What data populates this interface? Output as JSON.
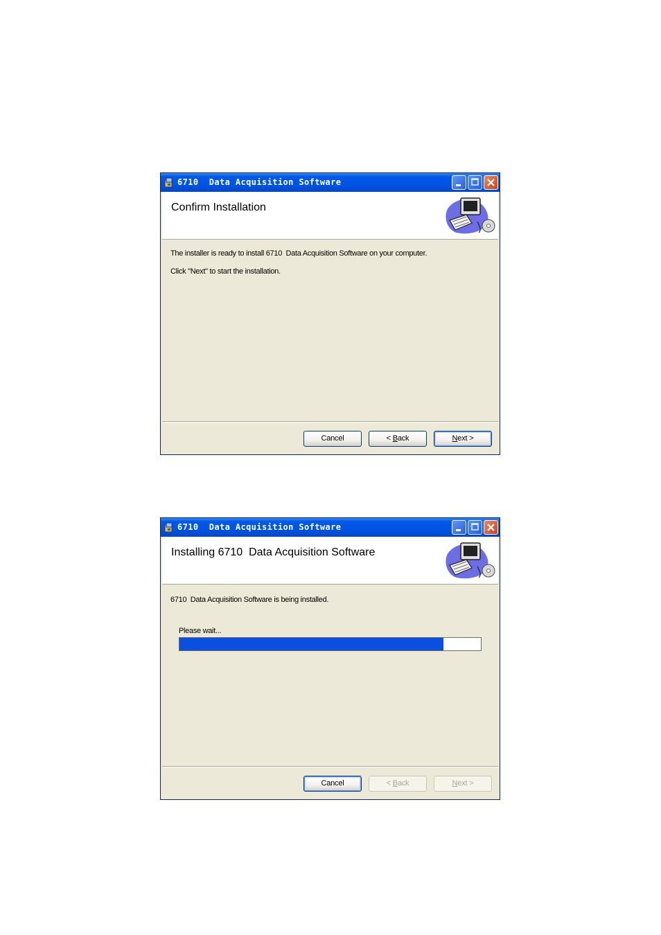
{
  "windows": [
    {
      "title": "6710  Data Acquisition Software",
      "header_title": "Confirm Installation",
      "body_lines": [
        "The installer is ready to install 6710  Data Acquisition Software on your computer.",
        "Click \"Next\" to start the installation."
      ],
      "buttons": {
        "cancel": {
          "label": "Cancel",
          "enabled": true
        },
        "back": {
          "prefix": "< ",
          "underlined": "B",
          "rest": "ack",
          "enabled": true
        },
        "next": {
          "underlined": "N",
          "rest": "ext >",
          "enabled": true,
          "default": true
        }
      }
    },
    {
      "title": "6710  Data Acquisition Software",
      "header_title": "Installing 6710  Data Acquisition Software",
      "status_text": "6710  Data Acquisition Software is being installed.",
      "progress_label": "Please wait...",
      "progress_fraction": 0.875,
      "buttons": {
        "cancel": {
          "label": "Cancel",
          "enabled": true,
          "default": true
        },
        "back": {
          "prefix": "< ",
          "underlined": "B",
          "rest": "ack",
          "enabled": false
        },
        "next": {
          "underlined": "N",
          "rest": "ext >",
          "enabled": false
        }
      }
    }
  ],
  "colors": {
    "titlebar": "#0054e3",
    "dialog_bg": "#ece9d8",
    "progress_fill": "#0a4fe0"
  },
  "icons": {
    "app": "installer-package-icon",
    "header_art": "computer-cd-icon",
    "minimize": "minimize-icon",
    "maximize": "maximize-icon",
    "close": "close-icon"
  }
}
